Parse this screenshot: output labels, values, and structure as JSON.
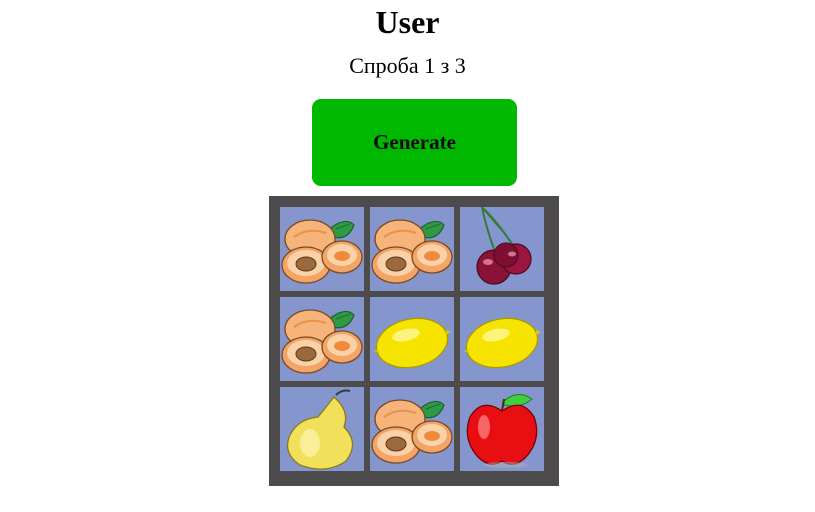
{
  "header": {
    "title": "User",
    "attempt_text": "Спроба 1 з 3"
  },
  "controls": {
    "generate_label": "Generate"
  },
  "colors": {
    "button_bg": "#00b800",
    "board_bg": "#4d4b4c",
    "cell_bg": "#8596cf"
  },
  "board": {
    "rows": [
      [
        "apricot",
        "apricot",
        "cherry"
      ],
      [
        "apricot",
        "lemon",
        "lemon"
      ],
      [
        "pear",
        "apricot",
        "apple"
      ]
    ]
  }
}
